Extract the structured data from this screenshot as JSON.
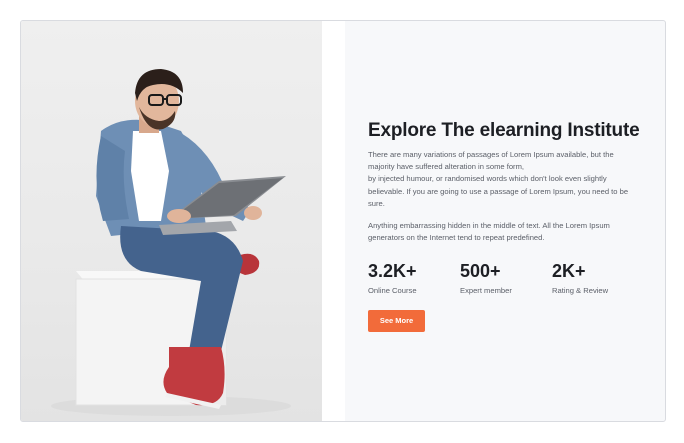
{
  "hero": {
    "image_label": "man-with-laptop-photo",
    "title": "Explore The elearning Institute",
    "paragraph1_lines": [
      "There are many variations of passages of Lorem Ipsum available, but the",
      "majority have suffered alteration in some form,",
      "by injected humour, or randomised words which don't look even slightly",
      "believable. If you are going to use a passage of Lorem Ipsum, you need to be",
      "sure."
    ],
    "paragraph2_lines": [
      "Anything embarrassing hidden in the middle of text. All the Lorem Ipsum",
      "generators on the Internet tend to repeat predefined."
    ],
    "stats": [
      {
        "value": "3.2K+",
        "label": "Online Course"
      },
      {
        "value": "500+",
        "label": "Expert member"
      },
      {
        "value": "2K+",
        "label": "Rating & Review"
      }
    ],
    "button_label": "See More"
  },
  "colors": {
    "accent": "#f26b3a",
    "panel_bg": "#f7f8fa",
    "heading": "#1d1f24",
    "body_text": "#5c6069"
  }
}
